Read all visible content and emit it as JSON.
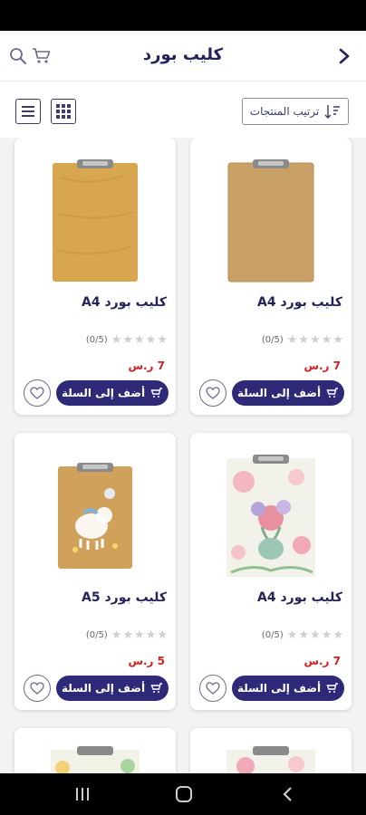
{
  "header": {
    "title": "كليب بورد",
    "back_icon": "chevron-right-icon",
    "cart_icon": "cart-icon",
    "search_icon": "search-icon"
  },
  "toolbar": {
    "sort_label": "ترتيب المنتجات",
    "sort_icon": "sort-icon",
    "grid_view_icon": "grid-view-icon",
    "list_view_icon": "list-view-icon"
  },
  "products": [
    {
      "name": "كليب بورد A4",
      "rating_count": "(0/5)",
      "price": "7 ر.س",
      "add_label": "أضف إلى السلة",
      "image": "wood-clipboard-dark"
    },
    {
      "name": "كليب بورد A4",
      "rating_count": "(0/5)",
      "price": "7 ر.س",
      "add_label": "أضف إلى السلة",
      "image": "wood-clipboard-light"
    },
    {
      "name": "كليب بورد A4",
      "rating_count": "(0/5)",
      "price": "7 ر.س",
      "add_label": "أضف إلى السلة",
      "image": "floral-clipboard"
    },
    {
      "name": "كليب بورد A5",
      "rating_count": "(0/5)",
      "price": "5 ر.س",
      "add_label": "أضف إلى السلة",
      "image": "unicorn-clipboard"
    }
  ],
  "colors": {
    "brand": "#2e2a78",
    "price": "#d32020"
  }
}
